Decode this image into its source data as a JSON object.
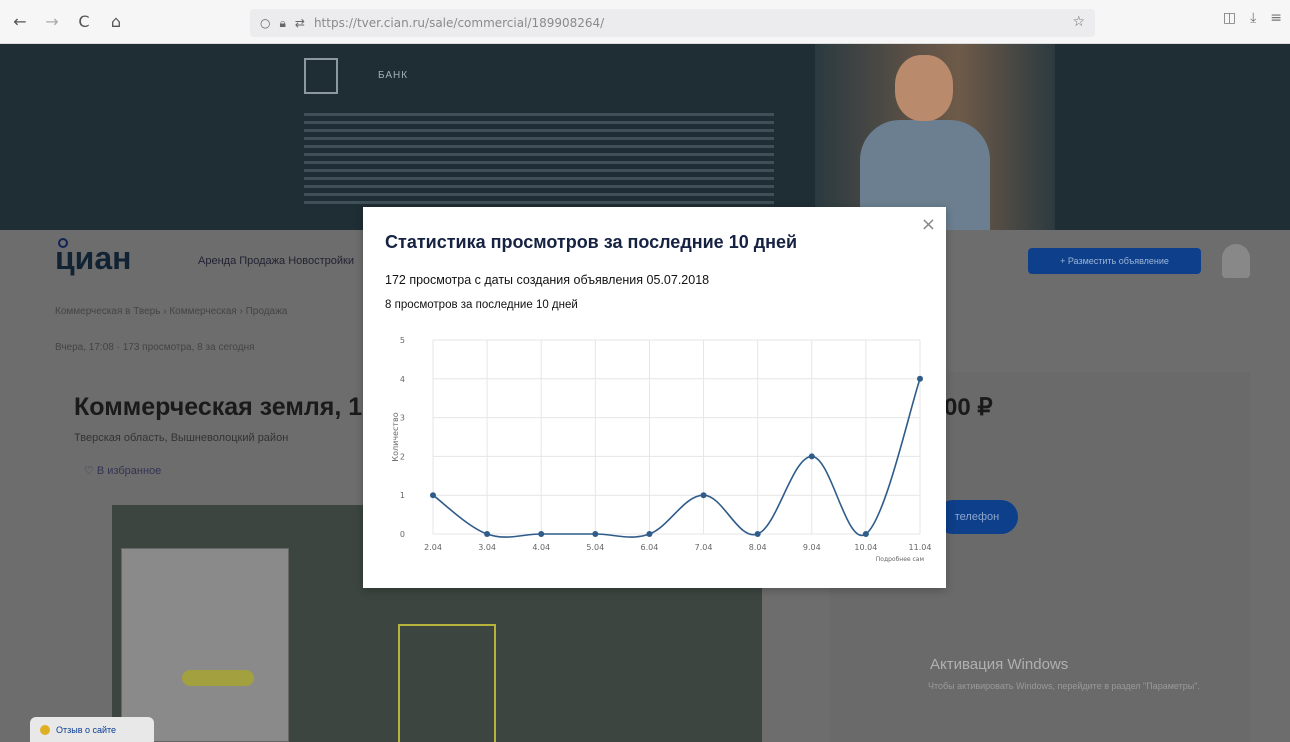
{
  "browser": {
    "url": "https://tver.cian.ru/sale/commercial/189908264/",
    "icons": [
      "back-icon",
      "forward-icon",
      "reload-icon",
      "home-icon",
      "shield-icon",
      "lock-icon",
      "permissions-icon",
      "star-icon",
      "pocket-icon",
      "download-icon",
      "menu-icon"
    ]
  },
  "banner": {
    "brand": "БАНК"
  },
  "site": {
    "logo": "циан",
    "nav": "Аренда  Продажа  Новостройки",
    "place_ad": "+ Разместить объявление",
    "breadcrumb": "Коммерческая в Тверь › Коммерческая › Продажа",
    "meta": "Вчера, 17:08  ·  173 просмотра, 8 за сегодня",
    "title": "Коммерческая земля, 15",
    "subtitle": "Тверская область, Вышневолоцкий район",
    "toolbar": "♡ В избранное",
    "price": "00 ₽",
    "phone_button": "телефон",
    "windows_title": "Активация Windows",
    "windows_text": "Чтобы активировать Windows, перейдите в раздел \"Параметры\".",
    "feedback": "Отзыв о сайте"
  },
  "modal": {
    "title": "Статистика просмотров за последние 10 дней",
    "line1": "172 просмотра с даты создания объявления 05.07.2018",
    "line2": "8 просмотров за последние 10 дней",
    "close_icon": "×"
  },
  "chart_data": {
    "type": "line",
    "categories": [
      "2.04",
      "3.04",
      "4.04",
      "5.04",
      "6.04",
      "7.04",
      "8.04",
      "9.04",
      "10.04",
      "11.04"
    ],
    "values": [
      1,
      0,
      0,
      0,
      0,
      1,
      0,
      2,
      0,
      4
    ],
    "ylabel": "Количество",
    "xlabel": "Подробнее сам",
    "ylim": [
      0,
      5
    ],
    "yticks": [
      "0",
      "1",
      "2",
      "3",
      "4",
      "5"
    ],
    "grid": true,
    "smooth": true,
    "color": "#2f5c8a"
  }
}
